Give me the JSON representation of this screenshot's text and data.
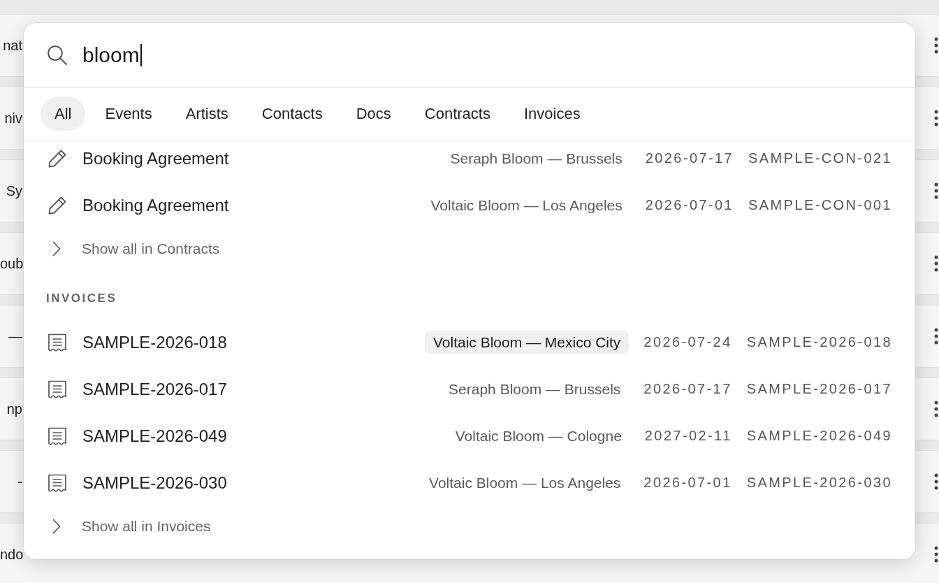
{
  "background_rows": [
    {
      "text": "nat"
    },
    {
      "text": "niv"
    },
    {
      "text": "Sy"
    },
    {
      "text": "oub"
    },
    {
      "text": "—"
    },
    {
      "text": "np"
    },
    {
      "text": "-"
    },
    {
      "text": "ndo"
    }
  ],
  "search": {
    "value": "bloom"
  },
  "tabs": [
    {
      "label": "All",
      "selected": true
    },
    {
      "label": "Events",
      "selected": false
    },
    {
      "label": "Artists",
      "selected": false
    },
    {
      "label": "Contacts",
      "selected": false
    },
    {
      "label": "Docs",
      "selected": false
    },
    {
      "label": "Contracts",
      "selected": false
    },
    {
      "label": "Invoices",
      "selected": false
    }
  ],
  "sections": [
    {
      "items": [
        {
          "kind": "contract",
          "title": "Booking Agreement",
          "subtitle": "Seraph Bloom — Brussels",
          "date": "2026-07-17",
          "reference": "SAMPLE-CON-021",
          "selected": false
        },
        {
          "kind": "contract",
          "title": "Booking Agreement",
          "subtitle": "Voltaic Bloom — Los Angeles",
          "date": "2026-07-01",
          "reference": "SAMPLE-CON-001",
          "selected": false
        }
      ],
      "show_all": "Show all in Contracts"
    },
    {
      "heading": "INVOICES",
      "items": [
        {
          "kind": "invoice",
          "title": "SAMPLE-2026-018",
          "subtitle": "Voltaic Bloom — Mexico City",
          "date": "2026-07-24",
          "reference": "SAMPLE-2026-018",
          "selected": true
        },
        {
          "kind": "invoice",
          "title": "SAMPLE-2026-017",
          "subtitle": "Seraph Bloom — Brussels",
          "date": "2026-07-17",
          "reference": "SAMPLE-2026-017",
          "selected": false
        },
        {
          "kind": "invoice",
          "title": "SAMPLE-2026-049",
          "subtitle": "Voltaic Bloom — Cologne",
          "date": "2027-02-11",
          "reference": "SAMPLE-2026-049",
          "selected": false
        },
        {
          "kind": "invoice",
          "title": "SAMPLE-2026-030",
          "subtitle": "Voltaic Bloom — Los Angeles",
          "date": "2026-07-01",
          "reference": "SAMPLE-2026-030",
          "selected": false
        }
      ],
      "show_all": "Show all in Invoices"
    }
  ]
}
